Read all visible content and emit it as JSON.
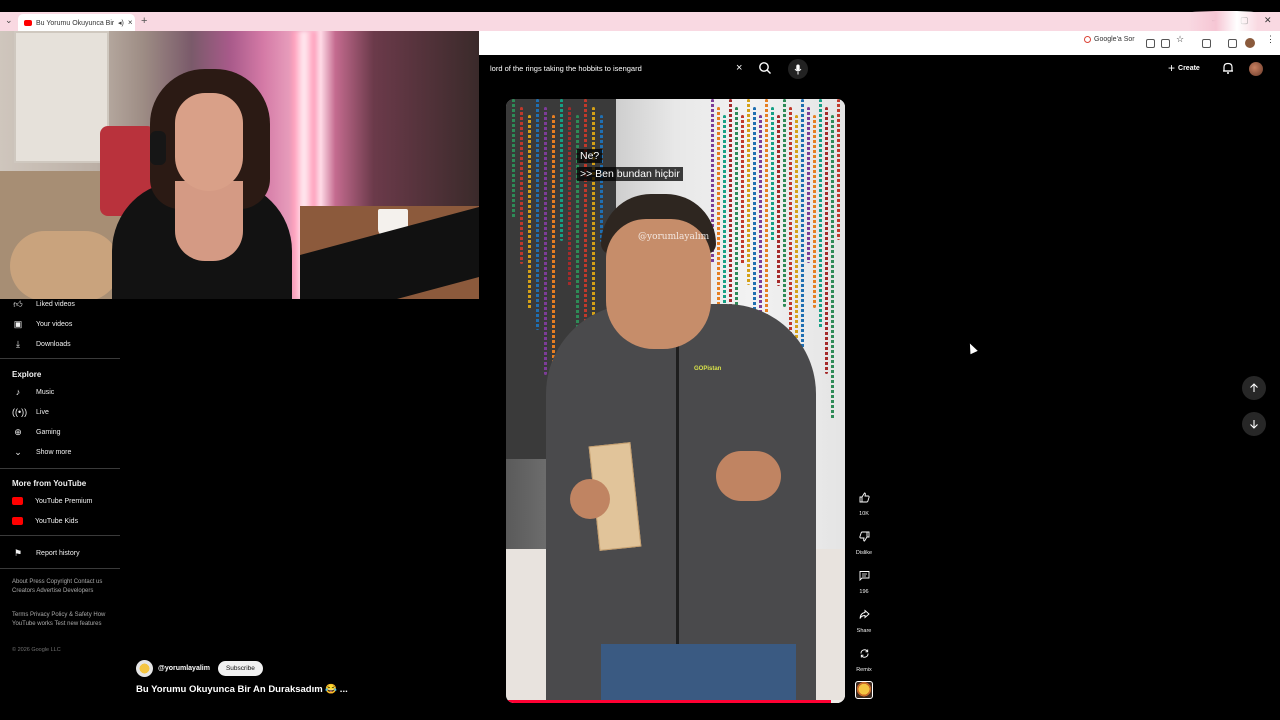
{
  "browser": {
    "tab_title": "Bu Yorumu Okuyunca Bir An Duraksadım 😂 - YouTube",
    "new_tab_glyph": "+",
    "close_glyph": "×",
    "ask_google": "Google'a Sor",
    "window_controls": [
      "—",
      "▢",
      "✕"
    ]
  },
  "header": {
    "search_value": "lord of the rings taking the hobbits to isengard",
    "create_label": "Create",
    "icons": [
      "search-icon",
      "mic-icon",
      "bell-icon",
      "plus-icon"
    ]
  },
  "sidebar": {
    "top_items": [
      {
        "label": "Liked videos",
        "icon": "thumb-up-icon"
      },
      {
        "label": "Your videos",
        "icon": "play-square-icon"
      },
      {
        "label": "Downloads",
        "icon": "download-icon"
      }
    ],
    "explore_heading": "Explore",
    "explore_items": [
      {
        "label": "Music",
        "icon": "music-note-icon"
      },
      {
        "label": "Live",
        "icon": "live-icon"
      },
      {
        "label": "Gaming",
        "icon": "gamepad-icon"
      },
      {
        "label": "Show more",
        "icon": "chevron-down-icon"
      }
    ],
    "more_heading": "More from YouTube",
    "more_items": [
      {
        "label": "YouTube Premium",
        "icon": "youtube-premium-icon"
      },
      {
        "label": "YouTube Kids",
        "icon": "youtube-kids-icon"
      }
    ],
    "report_label": "Report history",
    "footer_1": "About  Press  Copyright  Contact us  Creators  Advertise  Developers",
    "footer_2": "Terms  Privacy  Policy & Safety  How YouTube works  Test new features",
    "copyright": "© 2026 Google LLC"
  },
  "short": {
    "caption_line_1": "Ne?",
    "caption_line_2": ">> Ben bundan hiçbir",
    "watermark": "@yorumlayalım",
    "shirt_logo": "GOPistan",
    "progress": 0.96,
    "channel": "@yorumlayalim",
    "subscribe_label": "Subscribe",
    "title": "Bu Yorumu Okuyunca Bir An Duraksadım 😂 ..."
  },
  "actions": {
    "like_count": "10K",
    "dislike_label": "Dislike",
    "comment_count": "196",
    "share_label": "Share",
    "remix_label": "Remix"
  },
  "colors": {
    "accent": "#ff0033",
    "tabstrip": "#f9d9e2",
    "background": "#000000"
  }
}
